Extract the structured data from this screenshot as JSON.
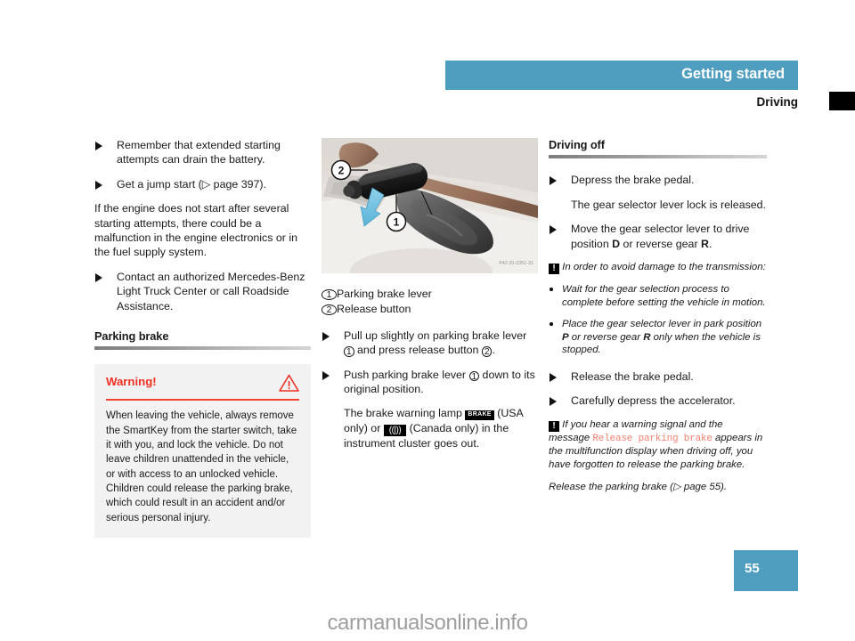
{
  "header": {
    "section_title": "Getting started",
    "subsection_title": "Driving"
  },
  "left_column": {
    "bullets_top": [
      "Remember that extended starting attempts can drain the battery.",
      "Get a jump start (▷ page 397)."
    ],
    "paragraph": "If the engine does not start after several starting attempts, there could be a malfunction in the engine electronics or in the fuel supply system.",
    "bullet_contact": "Contact an authorized Mercedes-Benz Light Truck Center or call Roadside Assistance.",
    "section_heading": "Parking brake",
    "warning": {
      "title": "Warning!",
      "icon": "warning-triangle-icon",
      "body": "When leaving the vehicle, always remove the SmartKey from the starter switch, take it with you, and lock the vehicle. Do not leave children unattended in the vehicle, or with access to an unlocked vehicle. Children could release the parking brake, which could result in an accident and/or serious personal injury."
    }
  },
  "middle_column": {
    "figure": {
      "alt": "Parking brake lever in center console with release button and downward arrow",
      "image_id": "P42.20-2351-31",
      "callout_1": "1",
      "callout_2": "2"
    },
    "legend": [
      {
        "num": "1",
        "label": "Parking brake lever"
      },
      {
        "num": "2",
        "label": "Release button"
      }
    ],
    "step_pull": {
      "part1": "Pull up slightly on parking brake lever ",
      "num1": "1",
      "part2": " and press release button ",
      "num2": "2",
      "part3": "."
    },
    "step_push": {
      "part1": "Push parking brake lever ",
      "num1": "1",
      "part2": " down to its original position."
    },
    "lamp_note": {
      "part1": "The brake warning lamp ",
      "badge_brake": "BRAKE",
      "part2": " (USA only) or ",
      "badge_canada": "((|))",
      "part3": " (Canada only) in the instrument cluster goes out."
    }
  },
  "right_column": {
    "section_heading": "Driving off",
    "step_depress": "Depress the brake pedal.",
    "sub_depress": "The gear selector lever lock is released.",
    "step_move": {
      "part1": "Move the gear selector lever to drive position ",
      "gear_d": "D",
      "part2": " or reverse gear ",
      "gear_r": "R",
      "part3": "."
    },
    "note_transmission": {
      "icon": "!",
      "text": "In order to avoid damage to the transmission:"
    },
    "transmission_bullets": [
      "Wait for the gear selection process to complete before setting the vehicle in motion."
    ],
    "bullet_park": {
      "part1": "Place the gear selector lever in park position ",
      "gear_p": "P",
      "part2": " or reverse gear ",
      "gear_r": "R",
      "part3": " only when the vehicle is stopped."
    },
    "step_release": "Release the brake pedal.",
    "step_accelerator": "Carefully depress the accelerator.",
    "note_warning": {
      "icon": "!",
      "part1": "If you hear a warning signal and the message ",
      "message": "Release parking brake",
      "part2": " appears in the multifunction display when driving off, you have forgotten to release the parking brake."
    },
    "closing_line": "Release the parking brake (▷ page 55)."
  },
  "footer": {
    "page_number": "55",
    "watermark": "carmanualsonline.info"
  },
  "colors": {
    "accent_blue": "#4f9ec0",
    "warning_red": "#ee3124",
    "message_salmon": "#f08070",
    "panel_gray": "#f2f2f2"
  }
}
